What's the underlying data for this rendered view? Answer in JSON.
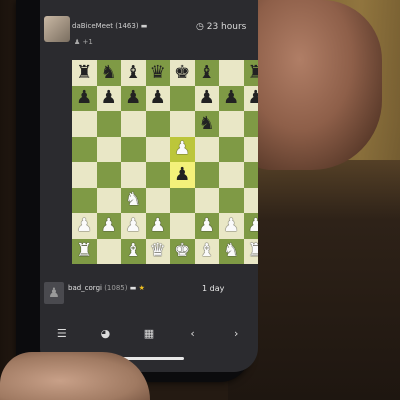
{
  "opponent": {
    "name": "daBiceMeet",
    "rating": "(1463)",
    "flag_icon": "flag-icon",
    "clock": "23 hours",
    "clock_icon": "clock-icon"
  },
  "board": {
    "rows": [
      [
        "r",
        "n",
        "b",
        "q",
        "k",
        "b",
        "",
        "r"
      ],
      [
        "p",
        "p",
        "p",
        "p",
        "",
        "p",
        "p",
        "p"
      ],
      [
        "",
        "",
        "",
        "",
        "",
        "n",
        "",
        ""
      ],
      [
        "",
        "",
        "",
        "",
        "P",
        "",
        "",
        ""
      ],
      [
        "",
        "",
        "",
        "",
        "p",
        "",
        "",
        ""
      ],
      [
        "",
        "",
        "N",
        "",
        "",
        "",
        "",
        ""
      ],
      [
        "P",
        "P",
        "P",
        "P",
        "",
        "P",
        "P",
        "P"
      ],
      [
        "R",
        "",
        "B",
        "Q",
        "K",
        "B",
        "N",
        "R"
      ]
    ],
    "highlight": [
      [
        3,
        4
      ],
      [
        4,
        4
      ]
    ],
    "colors": {
      "light": "#e9e7c6",
      "dark": "#7f9a45",
      "highlight_light": "#f4f17a",
      "highlight_dark": "#bcc63a"
    }
  },
  "player": {
    "name": "bad_corgi",
    "rating": "(1085)",
    "flag_icon": "flag-icon",
    "star_icon": "star-icon",
    "clock": "1 day"
  },
  "nav": [
    {
      "name": "moves-list-icon",
      "glyph": "☰"
    },
    {
      "name": "chat-icon",
      "glyph": "◕"
    },
    {
      "name": "analysis-icon",
      "glyph": "▦"
    },
    {
      "name": "back-arrow-icon",
      "glyph": "‹"
    },
    {
      "name": "forward-arrow-icon",
      "glyph": "›"
    }
  ]
}
